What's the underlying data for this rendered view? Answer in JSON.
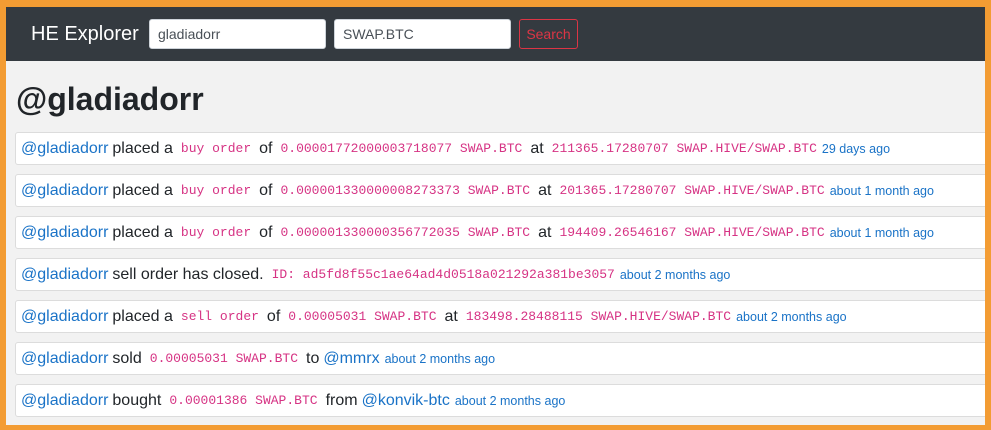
{
  "navbar": {
    "brand": "HE Explorer",
    "account_value": "gladiadorr",
    "symbol_value": "SWAP.BTC",
    "search_label": "Search"
  },
  "page_title": "@gladiadorr",
  "feed": [
    {
      "user": "@gladiadorr",
      "action": "placed a",
      "order": "buy order",
      "of": "of",
      "amount": "0.00001772000003718077 SWAP.BTC",
      "at": "at",
      "price": "211365.17280707 SWAP.HIVE/SWAP.BTC",
      "time": "29 days ago"
    },
    {
      "user": "@gladiadorr",
      "action": "placed a",
      "order": "buy order",
      "of": "of",
      "amount": "0.000001330000008273373 SWAP.BTC",
      "at": "at",
      "price": "201365.17280707 SWAP.HIVE/SWAP.BTC",
      "time": "about 1 month ago"
    },
    {
      "user": "@gladiadorr",
      "action": "placed a",
      "order": "buy order",
      "of": "of",
      "amount": "0.000001330000356772035 SWAP.BTC",
      "at": "at",
      "price": "194409.26546167 SWAP.HIVE/SWAP.BTC",
      "time": "about 1 month ago"
    },
    {
      "user": "@gladiadorr",
      "action": "sell order has closed.",
      "id": "ID: ad5fd8f55c1ae64ad4d0518a021292a381be3057",
      "time": "about 2 months ago"
    },
    {
      "user": "@gladiadorr",
      "action": "placed a",
      "order": "sell order",
      "of": "of",
      "amount": "0.00005031 SWAP.BTC",
      "at": "at",
      "price": "183498.28488115 SWAP.HIVE/SWAP.BTC",
      "time": "about 2 months ago"
    },
    {
      "user": "@gladiadorr",
      "action": "sold",
      "amount": "0.00005031 SWAP.BTC",
      "to": "to",
      "counterparty": "@mmrx",
      "time": "about 2 months ago"
    },
    {
      "user": "@gladiadorr",
      "action": "bought",
      "amount": "0.00001386 SWAP.BTC",
      "from": "from",
      "counterparty": "@konvik-btc",
      "time": "about 2 months ago"
    }
  ]
}
